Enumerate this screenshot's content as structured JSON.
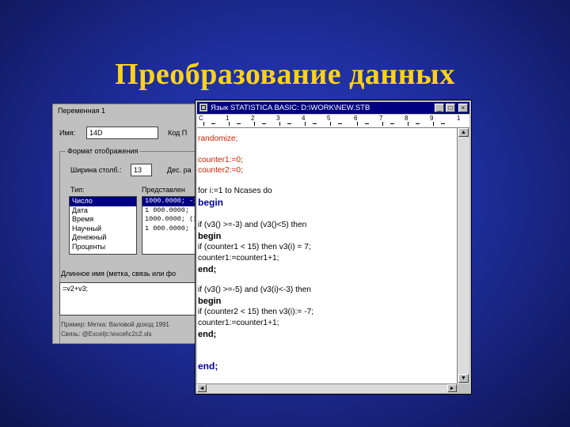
{
  "slide": {
    "title": "Преобразование данных"
  },
  "var_window": {
    "caption": "Переменная 1",
    "name_label": "Имя:",
    "name_value": "14D",
    "code_label": "Код П",
    "format_group": "Формат отображения",
    "width_label": "Ширина столб.:",
    "width_value": "13",
    "dec_label": "Дес. ра",
    "type_label": "Тип:",
    "repr_label": "Представлен",
    "types": [
      "Число",
      "Дата",
      "Время",
      "Научный",
      "Денежный",
      "Проценты"
    ],
    "selected_type": "Число",
    "representations": [
      "1000.0000; -1",
      "1 000.0000; -",
      "1000.0000; (1",
      "1 000.0000; ("
    ],
    "long_name_label": "Длинное имя (метка, связь или фо",
    "formula": "=v2+v3;",
    "note1": "Пример:  Метка: Валовой доход 1991",
    "note2": "Связь: @Excel|c:\\excel\\c2c2.xls"
  },
  "editor_window": {
    "title": "Язык STATISTICA BASIC: D:\\WORK\\NEW.STB",
    "ruler_numbers": [
      "C",
      "1",
      "2",
      "3",
      "4",
      "5",
      "6",
      "7",
      "8",
      "9",
      "1"
    ],
    "lines": [
      {
        "text": "randomize;",
        "style": "red"
      },
      {
        "text": "counter1:=0;",
        "style": "red"
      },
      {
        "text": "counter2:=0;",
        "style": "red"
      },
      {
        "text": "for i:=1 to Ncases do",
        "style": "plain"
      },
      {
        "text": "begin",
        "style": "kwblue"
      },
      {
        "text": "if (v3() >=-3) and (v3()<5) then",
        "style": "plain"
      },
      {
        "text": "begin",
        "style": "kw"
      },
      {
        "text": "if (counter1 < 15) then v3(i) = 7;",
        "style": "plain"
      },
      {
        "text": "counter1:=counter1+1;",
        "style": "plain"
      },
      {
        "text": "end;",
        "style": "kw"
      },
      {
        "text": "if (v3() >=-5) and (v3(i)<-3) then",
        "style": "plain"
      },
      {
        "text": "begin",
        "style": "kw"
      },
      {
        "text": "if (counter2 < 15) then v3(i):= -7;",
        "style": "plain"
      },
      {
        "text": "counter1:=counter1+1;",
        "style": "plain"
      },
      {
        "text": "end;",
        "style": "kw"
      },
      {
        "text": "end;",
        "style": "kwblue"
      }
    ]
  }
}
